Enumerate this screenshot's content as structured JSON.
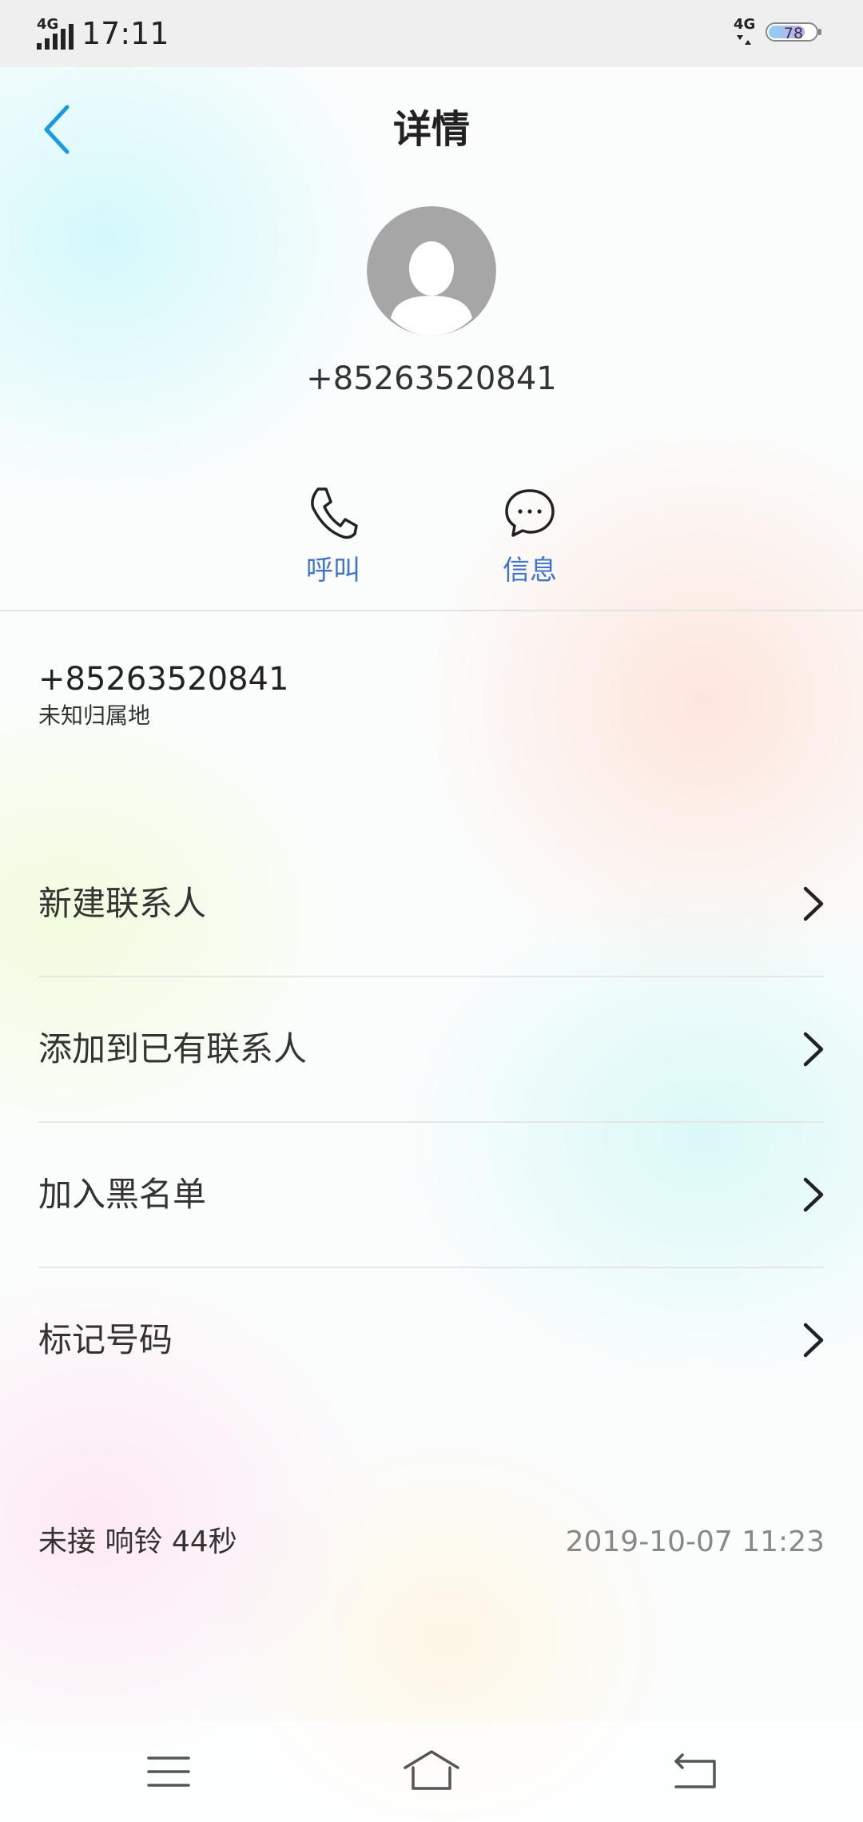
{
  "status_bar": {
    "signal_label": "4G",
    "time": "17:11",
    "network_label": "4G",
    "battery_level": 78,
    "battery_text": "78"
  },
  "header": {
    "title": "详情"
  },
  "contact": {
    "number": "+85263520841"
  },
  "actions": {
    "call_label": "呼叫",
    "message_label": "信息",
    "accent_color": "#3f74c8"
  },
  "info": {
    "number": "+85263520841",
    "location": "未知归属地"
  },
  "menu": {
    "items": [
      {
        "label": "新建联系人"
      },
      {
        "label": "添加到已有联系人"
      },
      {
        "label": "加入黑名单"
      },
      {
        "label": "标记号码"
      }
    ]
  },
  "call_log": {
    "status": "未接 响铃 44秒",
    "time": "2019-10-07 11:23"
  }
}
